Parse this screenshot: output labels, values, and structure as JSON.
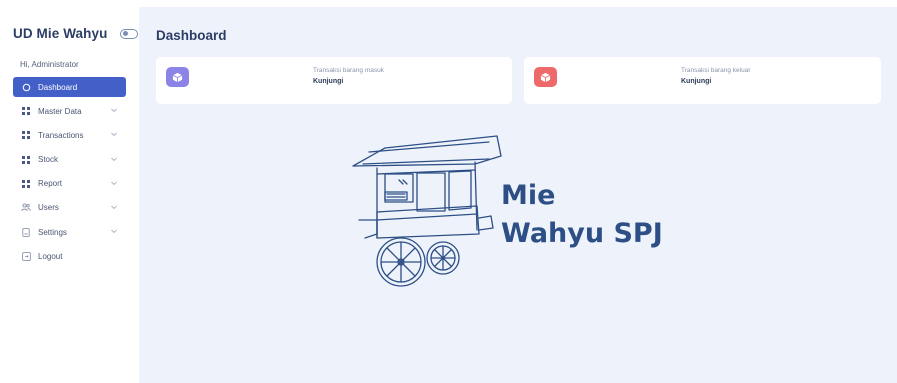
{
  "app": {
    "brand": "UD Mie Wahyu",
    "greeting": "Hi, Administrator"
  },
  "sidebar": {
    "items": [
      {
        "label": "Dashboard",
        "icon": "circle-icon",
        "active": true,
        "has_submenu": false
      },
      {
        "label": "Master Data",
        "icon": "grid-icon",
        "active": false,
        "has_submenu": true
      },
      {
        "label": "Transactions",
        "icon": "grid-icon",
        "active": false,
        "has_submenu": true
      },
      {
        "label": "Stock",
        "icon": "grid-icon",
        "active": false,
        "has_submenu": true
      },
      {
        "label": "Report",
        "icon": "grid-icon",
        "active": false,
        "has_submenu": true
      },
      {
        "label": "Users",
        "icon": "users-icon",
        "active": false,
        "has_submenu": true
      },
      {
        "label": "Settings",
        "icon": "document-icon",
        "active": false,
        "has_submenu": true
      },
      {
        "label": "Logout",
        "icon": "logout-icon",
        "active": false,
        "has_submenu": false
      }
    ]
  },
  "main": {
    "title": "Dashboard",
    "cards": [
      {
        "label": "Transaksi barang masuk",
        "link": "Kunjungi",
        "icon": "box-icon",
        "color": "#8c83e6"
      },
      {
        "label": "Transaksi barang keluar",
        "link": "Kunjungi",
        "icon": "box-icon",
        "color": "#ee6a6a"
      }
    ]
  },
  "logo": {
    "line1": "Mie",
    "line2": "Wahyu SPJ",
    "color": "#2d4f86"
  },
  "colors": {
    "accent": "#4360c9",
    "background": "#eef3fb"
  }
}
